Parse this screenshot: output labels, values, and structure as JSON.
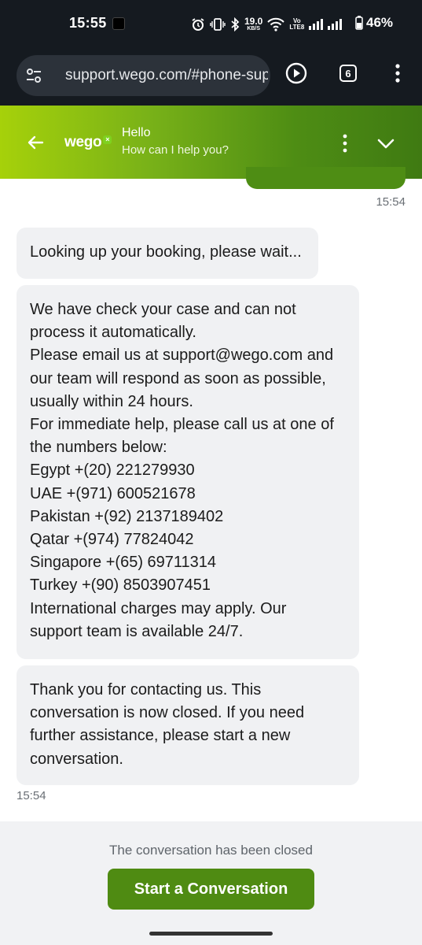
{
  "status_bar": {
    "time": "15:55",
    "net_speed_value": "19.0",
    "net_speed_unit": "KB/S",
    "volte_top": "Vo",
    "volte_bottom": "LTE8",
    "battery_percent": "46%"
  },
  "browser": {
    "url": "support.wego.com/#phone-support",
    "tab_count": "6"
  },
  "chat_header": {
    "brand": "wego",
    "title": "Hello",
    "subtitle": "How can I help you?"
  },
  "messages": {
    "timestamp_top": "15:54",
    "bubble_1": [
      "Looking up your booking, please wait..."
    ],
    "bubble_2": [
      "We have check your case and can not",
      "process it automatically.",
      "Please email us at support@wego.com and",
      "our team will respond as soon as possible,",
      "usually within 24 hours.",
      "For immediate help, please call us at one of",
      "the numbers below:",
      "Egypt +(20) 221279930",
      "UAE +(971) 600521678",
      "Pakistan +(92) 2137189402",
      "Qatar +(974) 77824042",
      "Singapore +(65) 69711314",
      "Turkey +(90) 8503907451",
      "International charges may apply. Our",
      "support team is available 24/7."
    ],
    "bubble_3": [
      "Thank you for contacting us. This",
      "conversation is now closed. If you need",
      "further assistance, please start a new",
      "conversation."
    ],
    "timestamp_bottom": "15:54"
  },
  "footer": {
    "closed_notice": "The conversation has been closed",
    "start_button": "Start a Conversation"
  },
  "colors": {
    "header_gradient_start": "#a6d10a",
    "header_gradient_end": "#3f7a12",
    "button_green": "#4f8b12",
    "bubble_gray": "#f0f1f3",
    "system_bar": "#151a20"
  },
  "icons": {
    "status": [
      "alarm-icon",
      "vibrate-icon",
      "bluetooth-icon",
      "wifi-icon",
      "signal-icon",
      "battery-icon"
    ],
    "browser": [
      "page-info-icon",
      "play-icon",
      "tabs-icon",
      "more-vert-icon"
    ],
    "header": [
      "back-arrow-icon",
      "more-vert-icon",
      "chevron-down-icon"
    ]
  }
}
